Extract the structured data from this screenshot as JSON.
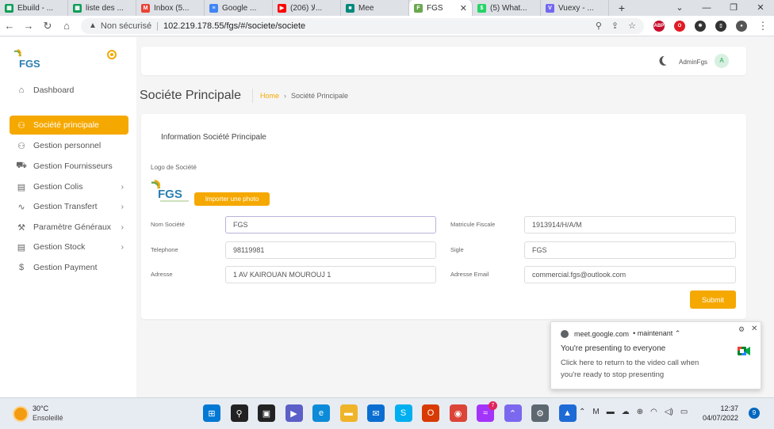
{
  "browser": {
    "tabs": [
      {
        "title": "Ebuild - ...",
        "icon": "sheets-icon",
        "color": "#0f9d58",
        "glyph": "▦"
      },
      {
        "title": "liste des ...",
        "icon": "sheets-icon",
        "color": "#0f9d58",
        "glyph": "▦"
      },
      {
        "title": "Inbox (5...",
        "icon": "gmail-icon",
        "color": "#ea4335",
        "glyph": "M"
      },
      {
        "title": "Google ...",
        "icon": "docs-icon",
        "color": "#4285f4",
        "glyph": "≡"
      },
      {
        "title": "(206) ﻻ...",
        "icon": "youtube-icon",
        "color": "#ff0000",
        "glyph": "▶"
      },
      {
        "title": "Mee",
        "icon": "meet-icon",
        "color": "#00897b",
        "glyph": "■"
      },
      {
        "title": "FGS",
        "icon": "fgs-icon",
        "color": "#6aa84f",
        "glyph": "F",
        "active": true
      },
      {
        "title": "(5) What...",
        "icon": "whatsapp-icon",
        "color": "#25d366",
        "glyph": "$"
      },
      {
        "title": "Vuexy - ...",
        "icon": "vuexy-icon",
        "color": "#7367f0",
        "glyph": "V"
      }
    ],
    "new_tab": "+",
    "address": {
      "security": "Non sécurisé",
      "url": "102.219.178.55/fgs/#/societe/societe"
    },
    "extensions": [
      {
        "name": "adblock-icon",
        "label": "ABP",
        "color": "#c70d2c"
      },
      {
        "name": "opera-icon",
        "label": "O",
        "color": "#e01b24"
      },
      {
        "name": "puzzle-icon",
        "label": "✱",
        "color": "#333333"
      },
      {
        "name": "sidepanel-icon",
        "label": "▯",
        "color": "#333333"
      },
      {
        "name": "profile-icon",
        "label": "●",
        "color": "#555555"
      }
    ]
  },
  "sidebar": {
    "brand": "FGS",
    "items": [
      {
        "label": "Dashboard",
        "icon": "home-icon",
        "glyph": "⌂",
        "chevron": false
      },
      {
        "label": "Société principale",
        "icon": "users-icon",
        "glyph": "⚇",
        "chevron": false,
        "active": true
      },
      {
        "label": "Gestion personnel",
        "icon": "users-icon",
        "glyph": "⚇",
        "chevron": false
      },
      {
        "label": "Gestion Fournisseurs",
        "icon": "truck-icon",
        "glyph": "⛟",
        "chevron": false
      },
      {
        "label": "Gestion Colis",
        "icon": "archive-icon",
        "glyph": "▤",
        "chevron": true
      },
      {
        "label": "Gestion Transfert",
        "icon": "activity-icon",
        "glyph": "∿",
        "chevron": true
      },
      {
        "label": "Paramètre Généraux",
        "icon": "tool-icon",
        "glyph": "⚒",
        "chevron": true
      },
      {
        "label": "Gestion Stock",
        "icon": "archive-icon",
        "glyph": "▤",
        "chevron": true
      },
      {
        "label": "Gestion Payment",
        "icon": "dollar-icon",
        "glyph": "$",
        "chevron": false
      }
    ]
  },
  "header": {
    "username": "AdminFgs",
    "avatar_initial": "A"
  },
  "page": {
    "title": "Sociéte Principale",
    "breadcrumb": {
      "home": "Home",
      "separator": "›",
      "current": "Société Principale"
    }
  },
  "form": {
    "title": "Information Société Principale",
    "logo_label": "Logo de Société",
    "upload_label": "Importer une photo",
    "fields": {
      "nom": {
        "label": "Nom Société",
        "value": "FGS"
      },
      "matricule": {
        "label": "Matricule Fiscale",
        "value": "1913914/H/A/M"
      },
      "telephone": {
        "label": "Telephone",
        "value": "98119981"
      },
      "sigle": {
        "label": "Sigle",
        "value": "FGS"
      },
      "adresse": {
        "label": "Adresse",
        "value": "1 AV KAIROUAN MOUROUJ 1"
      },
      "email": {
        "label": "Adresse Email",
        "value": "commercial.fgs@outlook.com"
      }
    },
    "submit_label": "Submit"
  },
  "meet_popup": {
    "source": "meet.google.com",
    "time": "• maintenant ⌃",
    "title": "You're presenting to everyone",
    "body": "Click here to return to the video call when you're ready to stop presenting"
  },
  "taskbar": {
    "weather": {
      "temp": "30°C",
      "condition": "Ensoleillé"
    },
    "apps": [
      {
        "name": "windows-start-icon",
        "color": "#0078d4",
        "glyph": "⊞"
      },
      {
        "name": "search-icon",
        "color": "#222222",
        "glyph": "⚲"
      },
      {
        "name": "taskview-icon",
        "color": "#222222",
        "glyph": "▣"
      },
      {
        "name": "teams-icon",
        "color": "#5b5fc7",
        "glyph": "▶"
      },
      {
        "name": "edge-icon",
        "color": "#0c8bd8",
        "glyph": "e"
      },
      {
        "name": "file-explorer-icon",
        "color": "#f0b429",
        "glyph": "▬"
      },
      {
        "name": "mail-icon",
        "color": "#0a6ed1",
        "glyph": "✉"
      },
      {
        "name": "skype-icon",
        "color": "#00aff0",
        "glyph": "S"
      },
      {
        "name": "office-icon",
        "color": "#d83b01",
        "glyph": "O"
      },
      {
        "name": "chrome-icon",
        "color": "#db4437",
        "glyph": "◉"
      },
      {
        "name": "messenger-icon",
        "color": "#a334fa",
        "glyph": "≈",
        "badge": "7"
      },
      {
        "name": "clickup-icon",
        "color": "#7b68ee",
        "glyph": "⌃"
      },
      {
        "name": "settings-icon",
        "color": "#5c6770",
        "glyph": "⚙"
      },
      {
        "name": "photos-icon",
        "color": "#1e6bd6",
        "glyph": "▲"
      }
    ],
    "tray": [
      "⌃",
      "M",
      "▬",
      "☁",
      "⊕",
      "◠",
      "◁)",
      "▭"
    ],
    "time": "12:37",
    "date": "04/07/2022",
    "notifications": "9"
  }
}
